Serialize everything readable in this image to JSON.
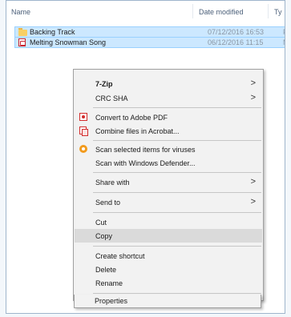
{
  "explorer": {
    "columns": {
      "name": "Name",
      "date": "Date modified",
      "type": "Ty"
    },
    "files": [
      {
        "name": "Backing Track",
        "date": "07/12/2016 16:53",
        "type": "Fi",
        "icon": "folder-icon",
        "selected": true
      },
      {
        "name": "Melting Snowman Song",
        "date": "06/12/2016 11:15",
        "type": "M",
        "icon": "pdf-icon",
        "selected": true
      }
    ]
  },
  "context_menu": {
    "seven_zip": "7-Zip",
    "crc_sha": "CRC SHA",
    "convert_pdf": "Convert to Adobe PDF",
    "combine_acrobat": "Combine files in Acrobat...",
    "scan_viruses": "Scan selected items for viruses",
    "scan_defender": "Scan with Windows Defender...",
    "share_with": "Share with",
    "send_to": "Send to",
    "cut": "Cut",
    "copy": "Copy",
    "create_shortcut": "Create shortcut",
    "delete": "Delete",
    "rename": "Rename",
    "properties": "Properties",
    "submenu_arrow": ">"
  },
  "colors": {
    "selection_bg": "#cce8ff",
    "menu_bg": "#f2f2f2",
    "highlight_bg": "#dadada",
    "pdf_red": "#d22c2c",
    "av_orange": "#f29b1d"
  }
}
